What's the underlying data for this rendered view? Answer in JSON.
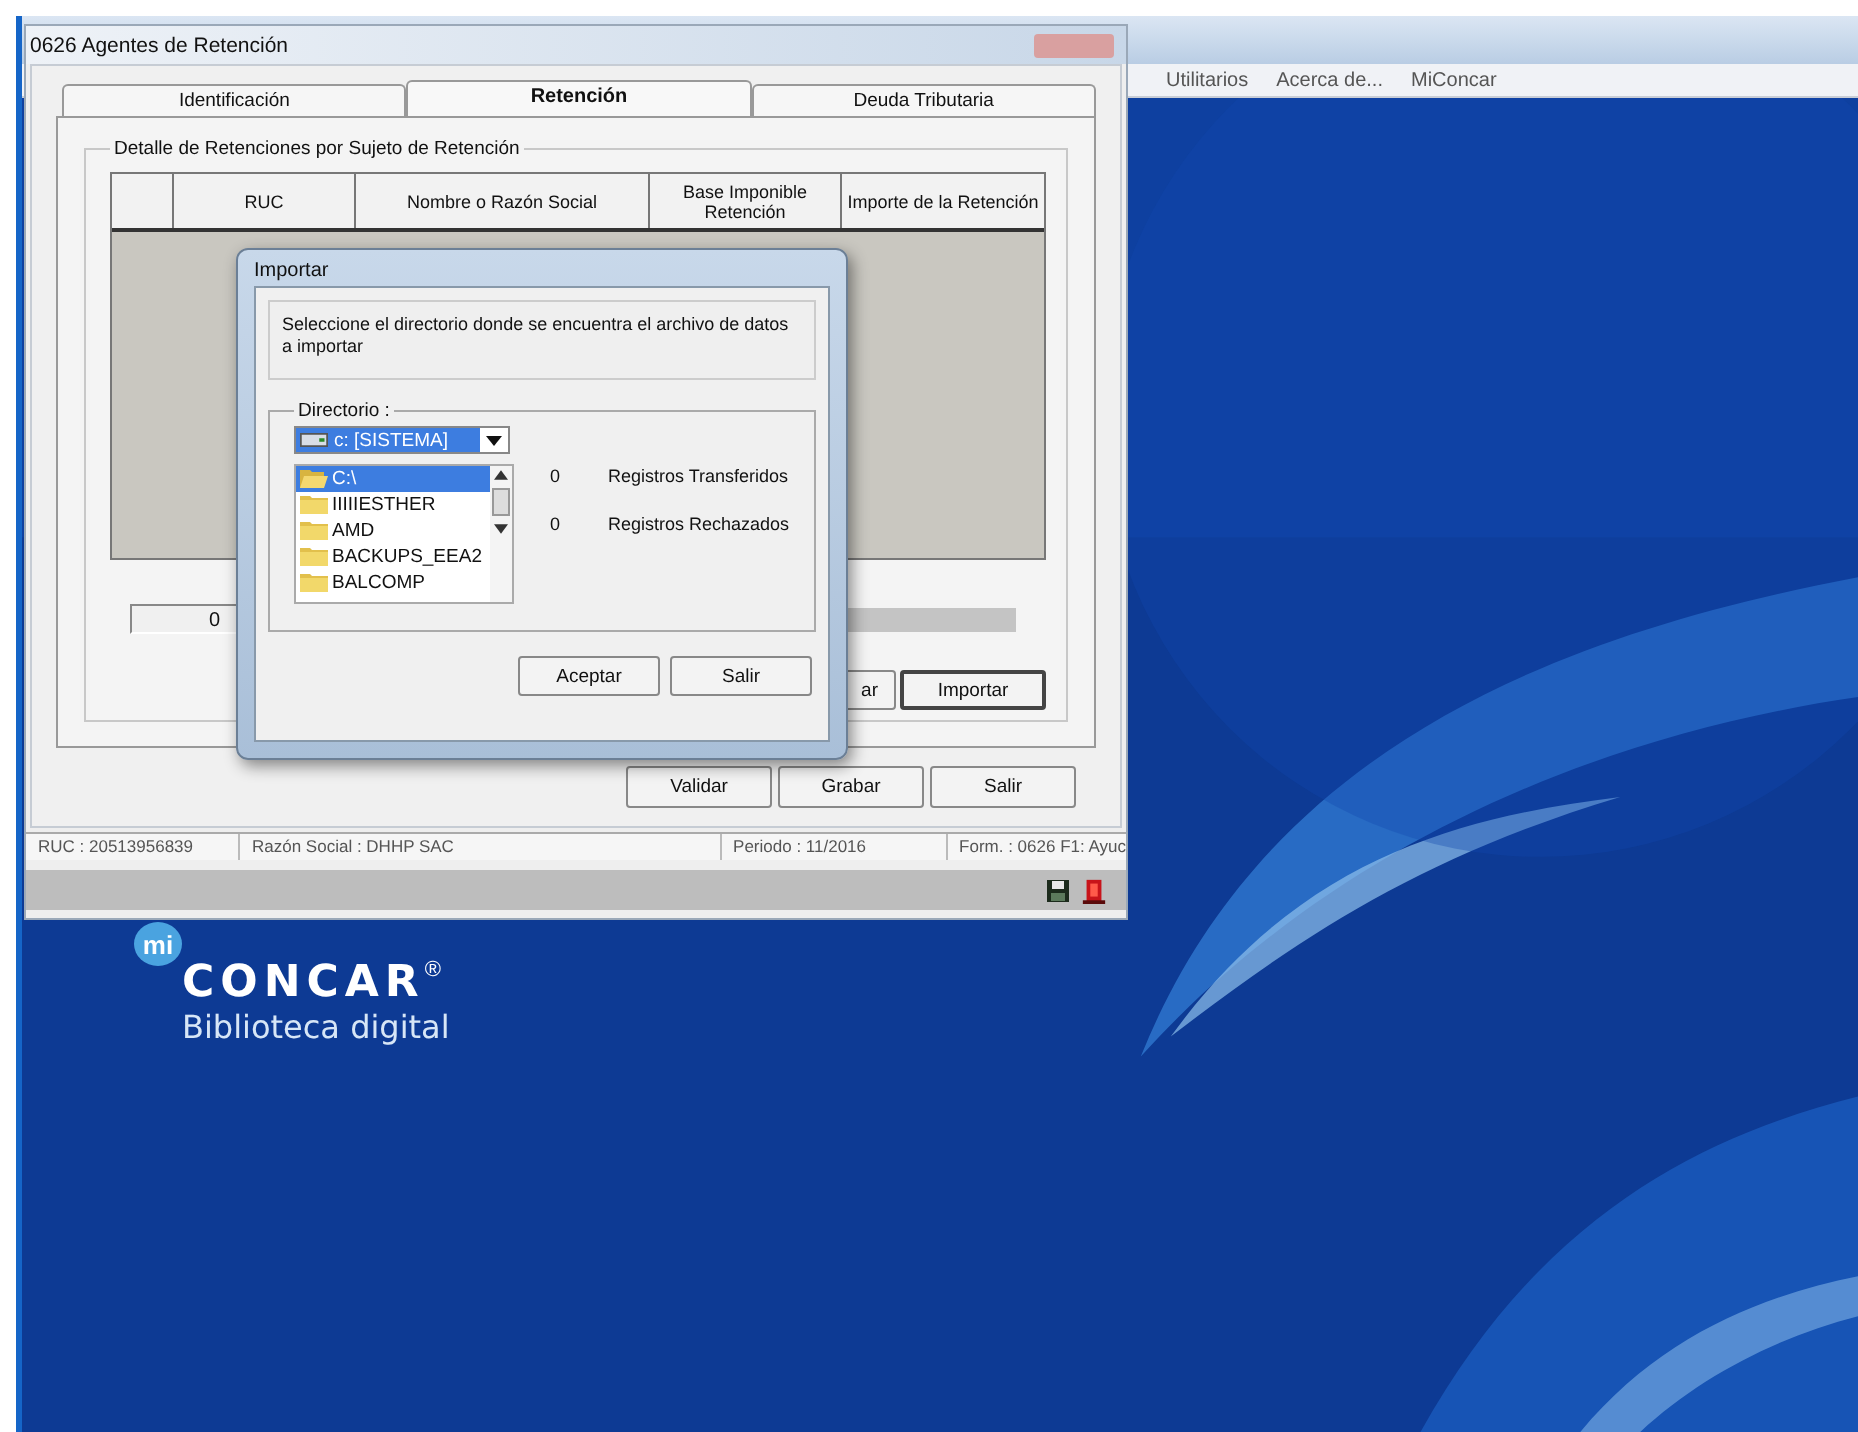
{
  "desktop": {
    "menu": [
      "Utilitarios",
      "Acerca de...",
      "MiConcar"
    ],
    "logo": {
      "badge": "mi",
      "name": "CONCAR",
      "mark": "®",
      "tagline": "Biblioteca digital"
    }
  },
  "window": {
    "title": "0626 Agentes de Retención",
    "tabs": [
      {
        "label": "Identificación",
        "selected": false
      },
      {
        "label": "Retención",
        "selected": true
      },
      {
        "label": "Deuda Tributaria",
        "selected": false
      }
    ],
    "group_title": "Detalle de Retenciones por Sujeto de Retención",
    "columns": [
      "RUC",
      "Nombre o Razón Social",
      "Base Imponible Retención",
      "Importe de la Retención"
    ],
    "counter_field": "0",
    "partial_button": "ar",
    "import_button": "Importar",
    "buttons": [
      "Validar",
      "Grabar",
      "Salir"
    ],
    "status_bar": [
      "RUC : 20513956839",
      "Razón Social : DHHP SAC",
      "Periodo : 11/2016",
      "Form. : 0626 F1: Ayuc"
    ]
  },
  "import_dialog": {
    "title": "Importar",
    "message": "Seleccione el directorio donde se encuentra el archivo de datos a importar",
    "directory_label": "Directorio :",
    "drive": "c: [SISTEMA]",
    "folders": [
      {
        "name": "C:\\",
        "kind": "open",
        "selected": true
      },
      {
        "name": "IIIIIESTHER",
        "kind": "closed",
        "selected": false
      },
      {
        "name": "AMD",
        "kind": "closed",
        "selected": false
      },
      {
        "name": "BACKUPS_EEA2",
        "kind": "closed",
        "selected": false
      },
      {
        "name": "BALCOMP",
        "kind": "closed",
        "selected": false
      }
    ],
    "stats": [
      {
        "count": "0",
        "label": "Registros Transferidos"
      },
      {
        "count": "0",
        "label": "Registros Rechazados"
      }
    ],
    "buttons": [
      "Aceptar",
      "Salir"
    ]
  }
}
